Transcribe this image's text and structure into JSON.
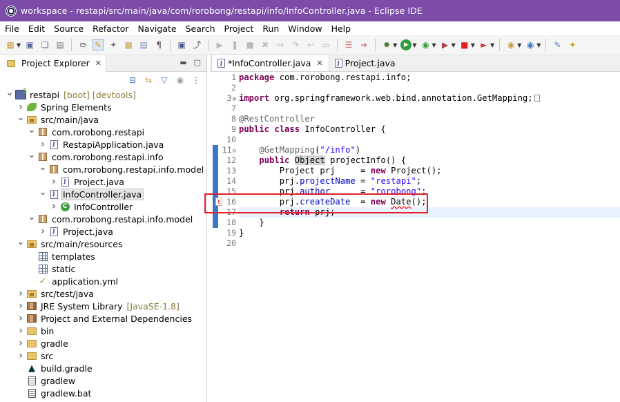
{
  "window": {
    "title": "workspace - restapi/src/main/java/com/rorobong/restapi/info/InfoController.java - Eclipse IDE"
  },
  "menu": [
    "File",
    "Edit",
    "Source",
    "Refactor",
    "Navigate",
    "Search",
    "Project",
    "Run",
    "Window",
    "Help"
  ],
  "toolbar_icons": [
    "new-icon",
    "save-icon",
    "save-all-icon",
    "pin-icon",
    "highlight-icon",
    "toggle-icon",
    "open-type-icon",
    "task-icon",
    "paragraph-icon",
    "terminal-icon",
    "link-icon",
    "skip-icon",
    "suspend-icon",
    "terminate-icon",
    "disconnect-icon",
    "step-into-icon",
    "step-over-icon",
    "step-return-icon",
    "drop-to-frame-icon",
    "use-step-filters-icon",
    "debug-icon",
    "run-icon",
    "coverage-icon",
    "external-tools-icon",
    "stop-icon",
    "launch-icon",
    "new-java-project-icon",
    "new-class-icon",
    "open-task-icon",
    "more-icon"
  ],
  "explorer": {
    "tab_label": "Project Explorer",
    "tree": [
      {
        "indent": 0,
        "arrow": "v",
        "icon": "project",
        "label": "restapi",
        "decoration": "[boot] [devtools]"
      },
      {
        "indent": 1,
        "arrow": ">",
        "icon": "spring",
        "label": "Spring Elements",
        "decoration": ""
      },
      {
        "indent": 1,
        "arrow": "v",
        "icon": "srcfolder",
        "label": "src/main/java",
        "decoration": ""
      },
      {
        "indent": 2,
        "arrow": "v",
        "icon": "package",
        "label": "com.rorobong.restapi",
        "decoration": ""
      },
      {
        "indent": 3,
        "arrow": ">",
        "icon": "java",
        "label": "RestapiApplication.java",
        "decoration": ""
      },
      {
        "indent": 2,
        "arrow": "v",
        "icon": "package",
        "label": "com.rorobong.restapi.info",
        "decoration": ""
      },
      {
        "indent": 3,
        "arrow": "v",
        "icon": "package",
        "label": "com.rorobong.restapi.info.model",
        "decoration": ""
      },
      {
        "indent": 4,
        "arrow": ">",
        "icon": "java",
        "label": "Project.java",
        "decoration": ""
      },
      {
        "indent": 3,
        "arrow": "v",
        "icon": "java",
        "label": "InfoController.java",
        "decoration": "",
        "selected": true
      },
      {
        "indent": 4,
        "arrow": ">",
        "icon": "class",
        "label": "InfoController",
        "decoration": ""
      },
      {
        "indent": 2,
        "arrow": "v",
        "icon": "package",
        "label": "com.rorobong.restapi.info.model",
        "decoration": ""
      },
      {
        "indent": 3,
        "arrow": ">",
        "icon": "java",
        "label": "Project.java",
        "decoration": ""
      },
      {
        "indent": 1,
        "arrow": "v",
        "icon": "srcfolder",
        "label": "src/main/resources",
        "decoration": ""
      },
      {
        "indent": 2,
        "arrow": "",
        "icon": "grid",
        "label": "templates",
        "decoration": ""
      },
      {
        "indent": 2,
        "arrow": "",
        "icon": "grid",
        "label": "static",
        "decoration": ""
      },
      {
        "indent": 2,
        "arrow": "",
        "icon": "yml",
        "label": "application.yml",
        "decoration": ""
      },
      {
        "indent": 1,
        "arrow": ">",
        "icon": "srcfolder",
        "label": "src/test/java",
        "decoration": ""
      },
      {
        "indent": 1,
        "arrow": ">",
        "icon": "lib",
        "label": "JRE System Library",
        "decoration": "[JavaSE-1.8]"
      },
      {
        "indent": 1,
        "arrow": ">",
        "icon": "lib",
        "label": "Project and External Dependencies",
        "decoration": ""
      },
      {
        "indent": 1,
        "arrow": ">",
        "icon": "folder",
        "label": "bin",
        "decoration": ""
      },
      {
        "indent": 1,
        "arrow": ">",
        "icon": "folder",
        "label": "gradle",
        "decoration": ""
      },
      {
        "indent": 1,
        "arrow": ">",
        "icon": "folder",
        "label": "src",
        "decoration": ""
      },
      {
        "indent": 1,
        "arrow": "",
        "icon": "gradle",
        "label": "build.gradle",
        "decoration": ""
      },
      {
        "indent": 1,
        "arrow": "",
        "icon": "doc",
        "label": "gradlew",
        "decoration": ""
      },
      {
        "indent": 1,
        "arrow": "",
        "icon": "doc",
        "label": "gradlew.bat",
        "decoration": ""
      }
    ]
  },
  "editor": {
    "tabs": [
      {
        "label": "*InfoController.java",
        "active": true
      },
      {
        "label": "Project.java",
        "active": false
      }
    ],
    "lines": [
      {
        "num": "1",
        "html": "<span class=\"kw\">package</span> com.rorobong.restapi.info;"
      },
      {
        "num": "2",
        "html": ""
      },
      {
        "num": "3",
        "html": "<span class=\"kw\">import</span> org.springframework.web.bind.annotation.GetMapping;<span class=\"collapsed-box\"></span>",
        "fold": "+"
      },
      {
        "num": "7",
        "html": ""
      },
      {
        "num": "8",
        "html": "<span class=\"ann\">@RestController</span>"
      },
      {
        "num": "9",
        "html": "<span class=\"kw\">public</span> <span class=\"kw\">class</span> InfoController {"
      },
      {
        "num": "10",
        "html": ""
      },
      {
        "num": "11",
        "html": "    <span class=\"ann\">@GetMapping</span>(<span class=\"str\">\"/info\"</span>)",
        "fold": "-"
      },
      {
        "num": "12",
        "html": "    <span class=\"kw\">public</span> <span class=\"hl\">Object</span> projectInfo() {"
      },
      {
        "num": "13",
        "html": "        Project prj     = <span class=\"kw\">new</span> Project();"
      },
      {
        "num": "14",
        "html": "        prj.<span class=\"fld\">projectName</span> = <span class=\"str\">\"restapi\"</span>;"
      },
      {
        "num": "15",
        "html": "        prj.<span class=\"fld\">author</span>      = <span class=\"str\">\"rorobong\"</span>;"
      },
      {
        "num": "16",
        "html": "        prj.<span class=\"fld\">createDate</span>  = <span class=\"kw\">new</span> <span class=\"err\">Date</span>();",
        "error": true
      },
      {
        "num": "17",
        "html": "        <span class=\"kw\">return</span> prj;",
        "current": true
      },
      {
        "num": "18",
        "html": "    }"
      },
      {
        "num": "19",
        "html": "}"
      },
      {
        "num": "20",
        "html": ""
      }
    ]
  }
}
